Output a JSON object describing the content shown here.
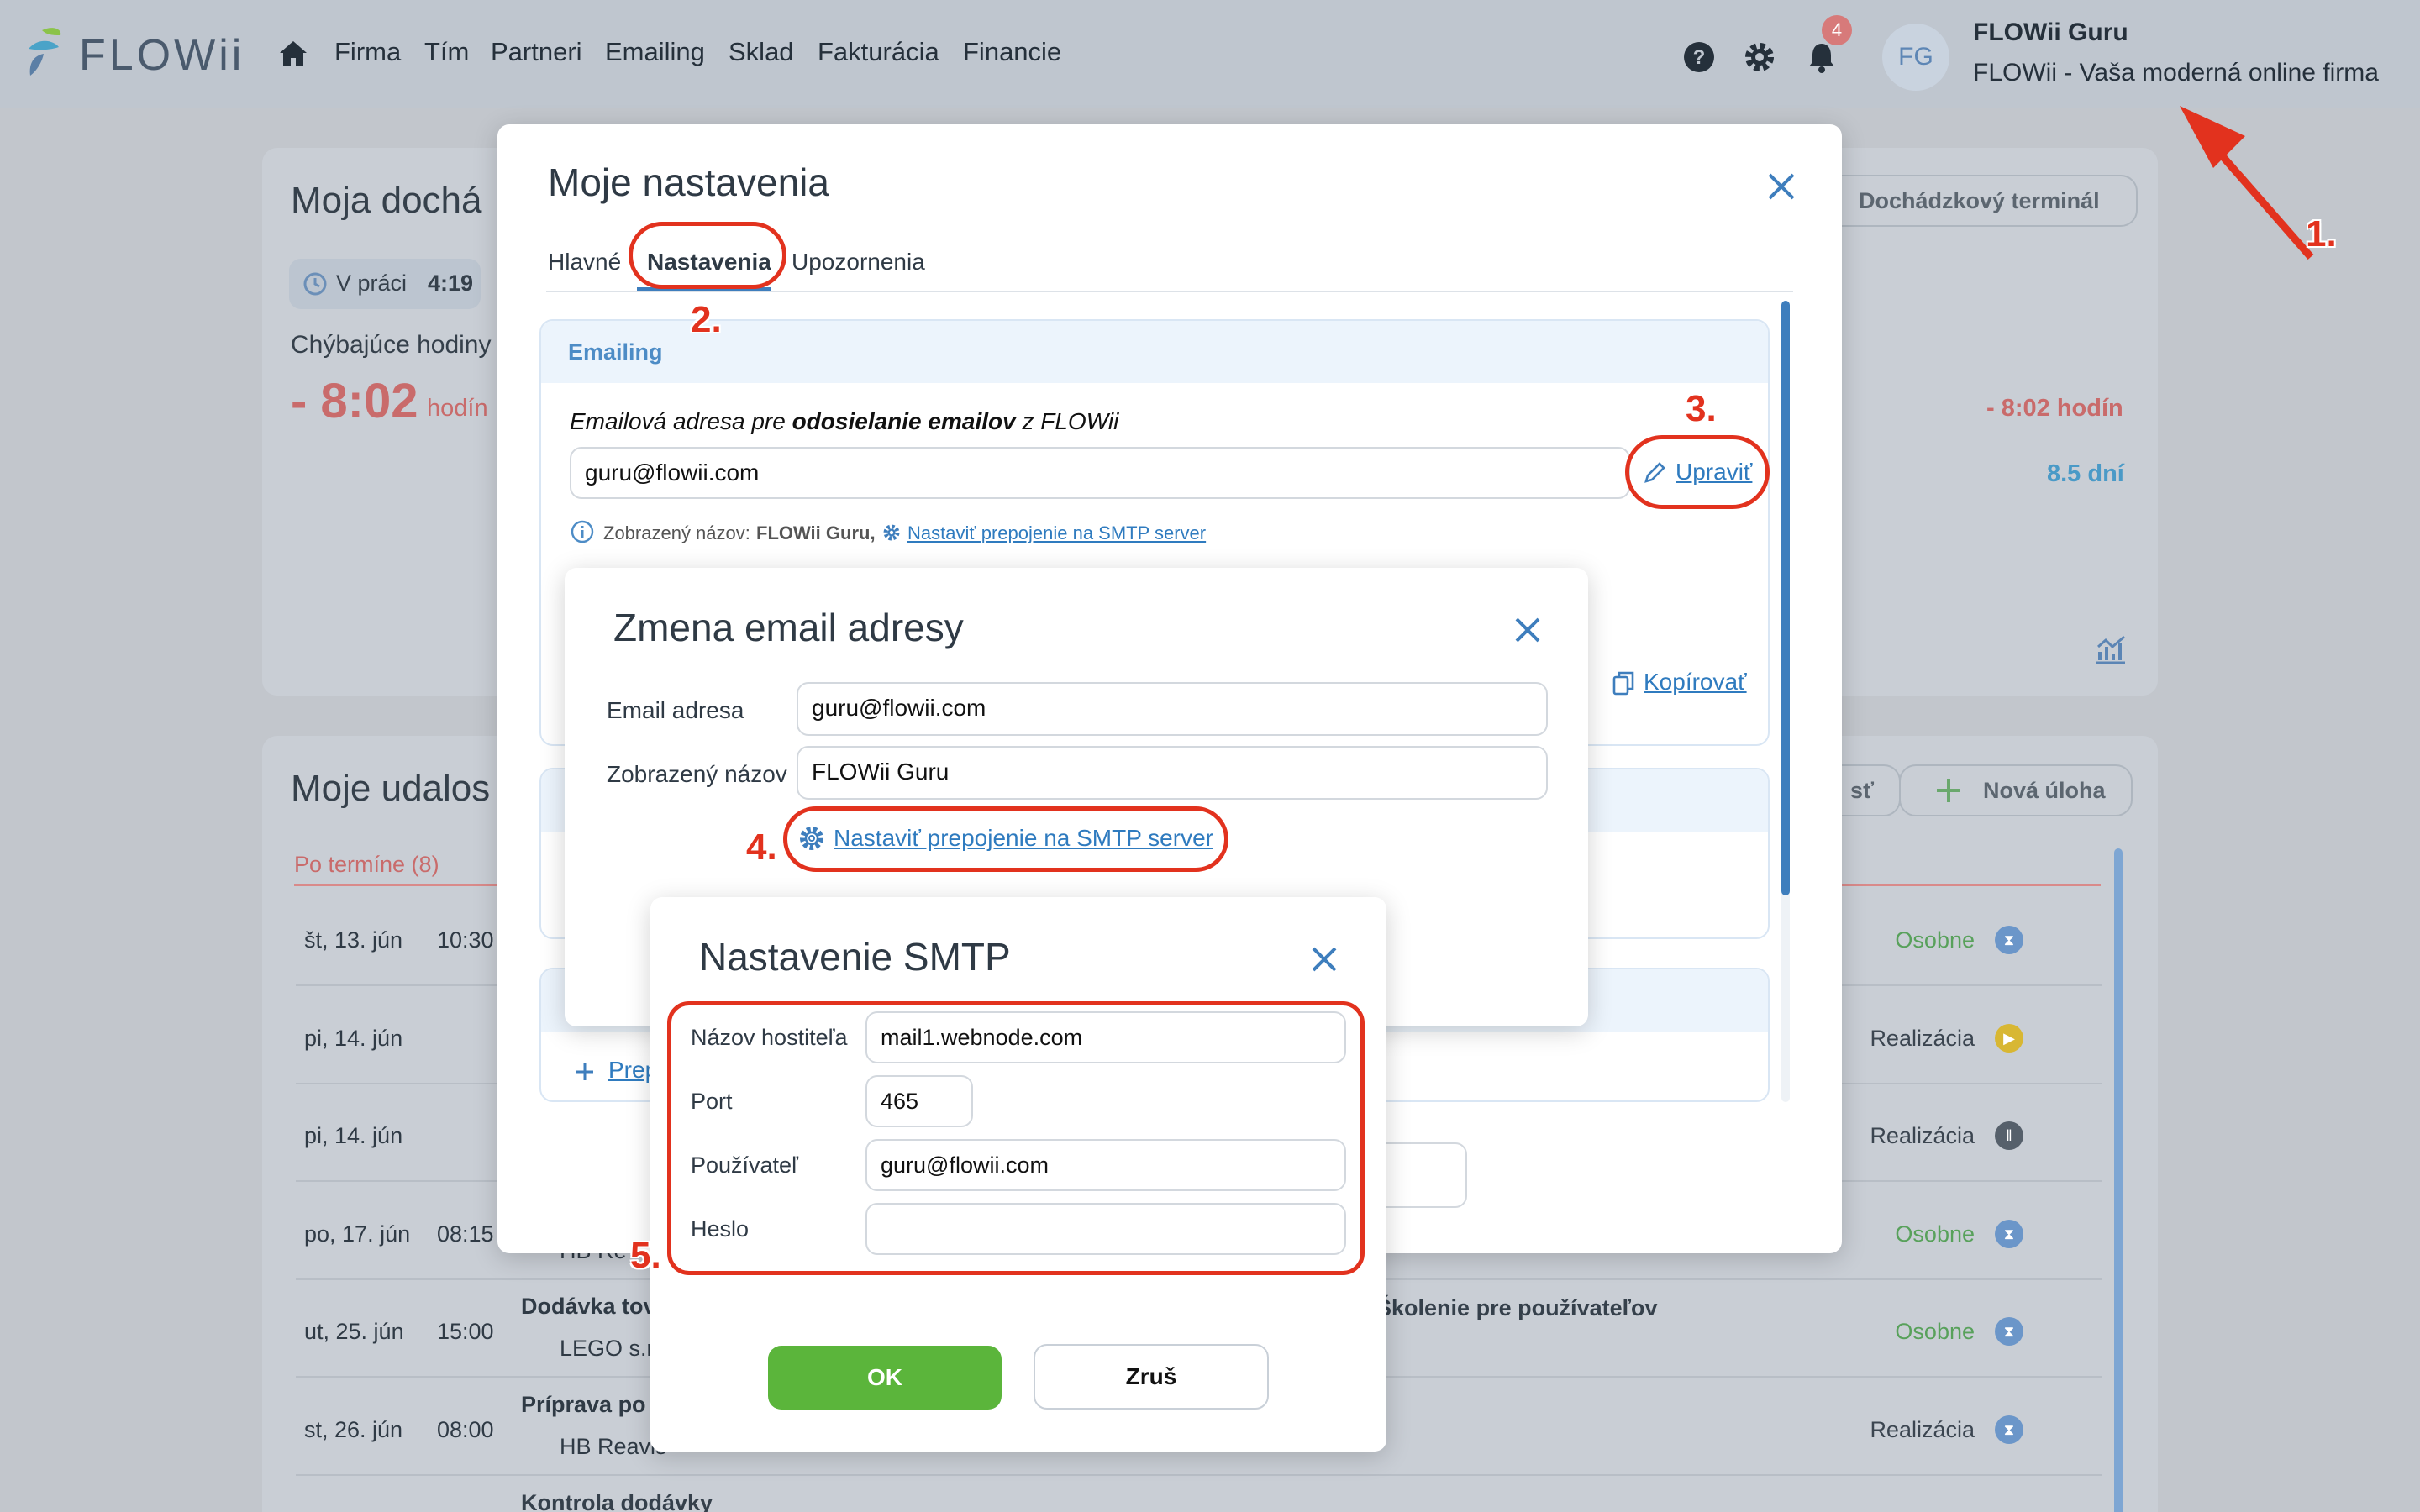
{
  "app": {
    "logo": "FLOWii",
    "nav": [
      "Firma",
      "Tím",
      "Partneri",
      "Emailing",
      "Sklad",
      "Fakturácia",
      "Financie"
    ],
    "notification_count": "4",
    "avatar_initials": "FG",
    "user_name": "FLOWii Guru",
    "user_subtitle": "FLOWii - Vaša moderná online firma"
  },
  "background": {
    "attendance": {
      "title": "Moja dochá",
      "status_prefix": "V práci",
      "status_time": "4:19",
      "missing_label": "Chýbajúce hodiny",
      "missing_value": "- 8:02",
      "missing_unit": "hodín",
      "terminal_button": "Dochádzkový terminál",
      "right_hours": "- 8:02 hodín",
      "right_days": "8.5 dní"
    },
    "events": {
      "title": "Moje udalos",
      "overdue_label": "Po termíne (8)",
      "btn_partial": "sť",
      "new_task_button": "Nová úloha",
      "rows": [
        {
          "date": "št, 13. jún",
          "time": "10:30",
          "tag": "Osobne",
          "tag_color": "#58a15b",
          "icon": "hourglass-icon",
          "icon_color": "#6b96c9",
          "title": "",
          "sub": ""
        },
        {
          "date": "pi, 14. jún",
          "time": "",
          "tag": "Realizácia",
          "tag_color": "#3b4550",
          "icon": "play-icon",
          "icon_color": "#d8b733",
          "title": "",
          "sub": ""
        },
        {
          "date": "pi, 14. jún",
          "time": "",
          "tag": "Realizácia",
          "tag_color": "#3b4550",
          "icon": "pause-icon",
          "icon_color": "#56606b",
          "title": "",
          "sub": ""
        },
        {
          "date": "po, 17. jún",
          "time": "08:15",
          "tag": "Osobne",
          "tag_color": "#58a15b",
          "icon": "hourglass-icon",
          "icon_color": "#6b96c9",
          "title": "",
          "sub": "HB Re"
        },
        {
          "date": "ut, 25. jún",
          "time": "15:00",
          "tag": "Osobne",
          "tag_color": "#58a15b",
          "icon": "hourglass-icon",
          "icon_color": "#6b96c9",
          "title": "Dodávka tov",
          "sub": "LEGO s.r"
        },
        {
          "date": "st, 26. jún",
          "time": "08:00",
          "tag": "Realizácia",
          "tag_color": "#3b4550",
          "icon": "hourglass-icon",
          "icon_color": "#6b96c9",
          "title": "Príprava po",
          "sub": "HB Reavis"
        }
      ],
      "extra_text": "ie Školenie pre používateľov",
      "last_title": "Kontrola dodávky"
    }
  },
  "settings_modal": {
    "title": "Moje nastavenia",
    "tabs": [
      "Hlavné",
      "Nastavenia",
      "Upozornenia"
    ],
    "active_tab": "Nastavenia",
    "section_title": "Emailing",
    "email_label_1": "Emailová adresa pre ",
    "email_label_bold": "odosielanie emailov",
    "email_label_2": " z FLOWii",
    "email_value": "guru@flowii.com",
    "edit_link": "Upraviť",
    "display_name_prefix": "Zobrazený názov:",
    "display_name_value": "FLOWii Guru,",
    "smtp_link": "Nastaviť prepojenie na SMTP server",
    "copy_link": "Kopírovať",
    "add_link": "Prep"
  },
  "change_email_modal": {
    "title": "Zmena email adresy",
    "email_label": "Email adresa",
    "email_value": "guru@flowii.com",
    "name_label": "Zobrazený názov",
    "name_value": "FLOWii Guru",
    "smtp_link": "Nastaviť prepojenie na SMTP server"
  },
  "smtp_modal": {
    "title": "Nastavenie SMTP",
    "host_label": "Názov hostiteľa",
    "host_value": "mail1.webnode.com",
    "port_label": "Port",
    "port_value": "465",
    "user_label": "Používateľ",
    "user_value": "guru@flowii.com",
    "password_label": "Heslo",
    "password_value": "",
    "ok_button": "OK",
    "cancel_button": "Zruš"
  },
  "annotations": [
    "1.",
    "2.",
    "3.",
    "4.",
    "5."
  ],
  "colors": {
    "accent_blue": "#2f7bbf",
    "ok_green": "#5bb53b",
    "annotation_red": "#e2321e",
    "negative_red": "#d05a5a"
  }
}
